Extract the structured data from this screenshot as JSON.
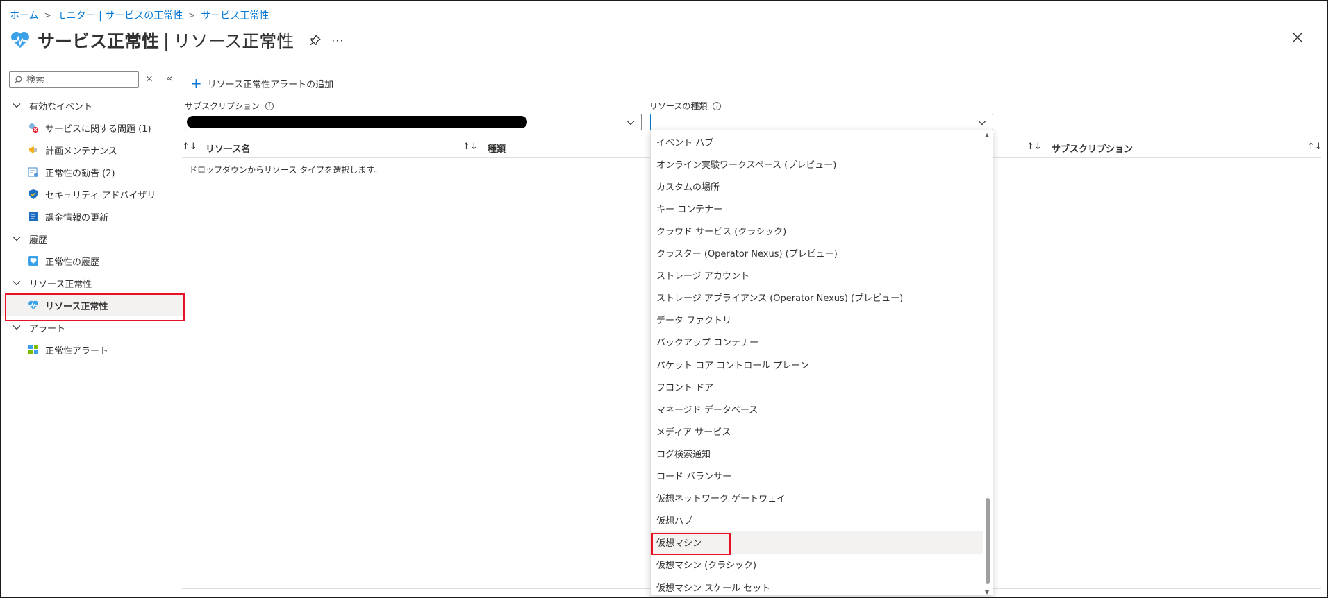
{
  "breadcrumb": [
    {
      "label": "ホーム"
    },
    {
      "label": "モニター | サービスの正常性"
    },
    {
      "label": "サービス正常性"
    }
  ],
  "header": {
    "title": "サービス正常性",
    "separator": "|",
    "subtitle": "リソース正常性",
    "more": "···"
  },
  "sidebar": {
    "search_placeholder": "検索",
    "clear": "×",
    "collapse": "«",
    "groups": [
      {
        "label": "有効なイベント",
        "items": [
          {
            "label": "サービスに関する問題 (1)",
            "icon": "service-issues-icon"
          },
          {
            "label": "計画メンテナンス",
            "icon": "megaphone-icon"
          },
          {
            "label": "正常性の勧告 (2)",
            "icon": "advisory-icon"
          },
          {
            "label": "セキュリティ アドバイザリ",
            "icon": "shield-icon"
          },
          {
            "label": "課金情報の更新",
            "icon": "billing-icon"
          }
        ]
      },
      {
        "label": "履歴",
        "items": [
          {
            "label": "正常性の履歴",
            "icon": "health-history-icon"
          }
        ]
      },
      {
        "label": "リソース正常性",
        "items": [
          {
            "label": "リソース正常性",
            "icon": "heart-pulse-icon",
            "selected": true
          }
        ]
      },
      {
        "label": "アラート",
        "items": [
          {
            "label": "正常性アラート",
            "icon": "health-alert-icon"
          }
        ]
      }
    ]
  },
  "toolbar": {
    "add_alert": "リソース正常性アラートの追加",
    "plus": "+"
  },
  "filters": {
    "subscription_label": "サブスクリプション",
    "resource_type_label": "リソースの種類",
    "info": "i"
  },
  "grid": {
    "sort": "↑↓",
    "columns": [
      "リソース名",
      "種類",
      "サブスクリプション"
    ],
    "empty_message": "ドロップダウンからリソース タイプを選択します。"
  },
  "resource_types": [
    "イベント ハブ",
    "オンライン実験ワークスペース (プレビュー)",
    "カスタムの場所",
    "キー コンテナー",
    "クラウド サービス (クラシック)",
    "クラスター (Operator Nexus) (プレビュー)",
    "ストレージ アカウント",
    "ストレージ アプライアンス (Operator Nexus) (プレビュー)",
    "データ ファクトリ",
    "バックアップ コンテナー",
    "パケット コア コントロール プレーン",
    "フロント ドア",
    "マネージド データベース",
    "メディア サービス",
    "ログ検索通知",
    "ロード バランサー",
    "仮想ネットワーク ゲートウェイ",
    "仮想ハブ",
    "仮想マシン",
    "仮想マシン (クラシック)",
    "仮想マシン スケール セット"
  ],
  "highlighted_type": "仮想マシン",
  "colors": {
    "accent": "#0078d4",
    "highlight_box": "#e81123",
    "selected_bg": "#f3f2f1"
  }
}
